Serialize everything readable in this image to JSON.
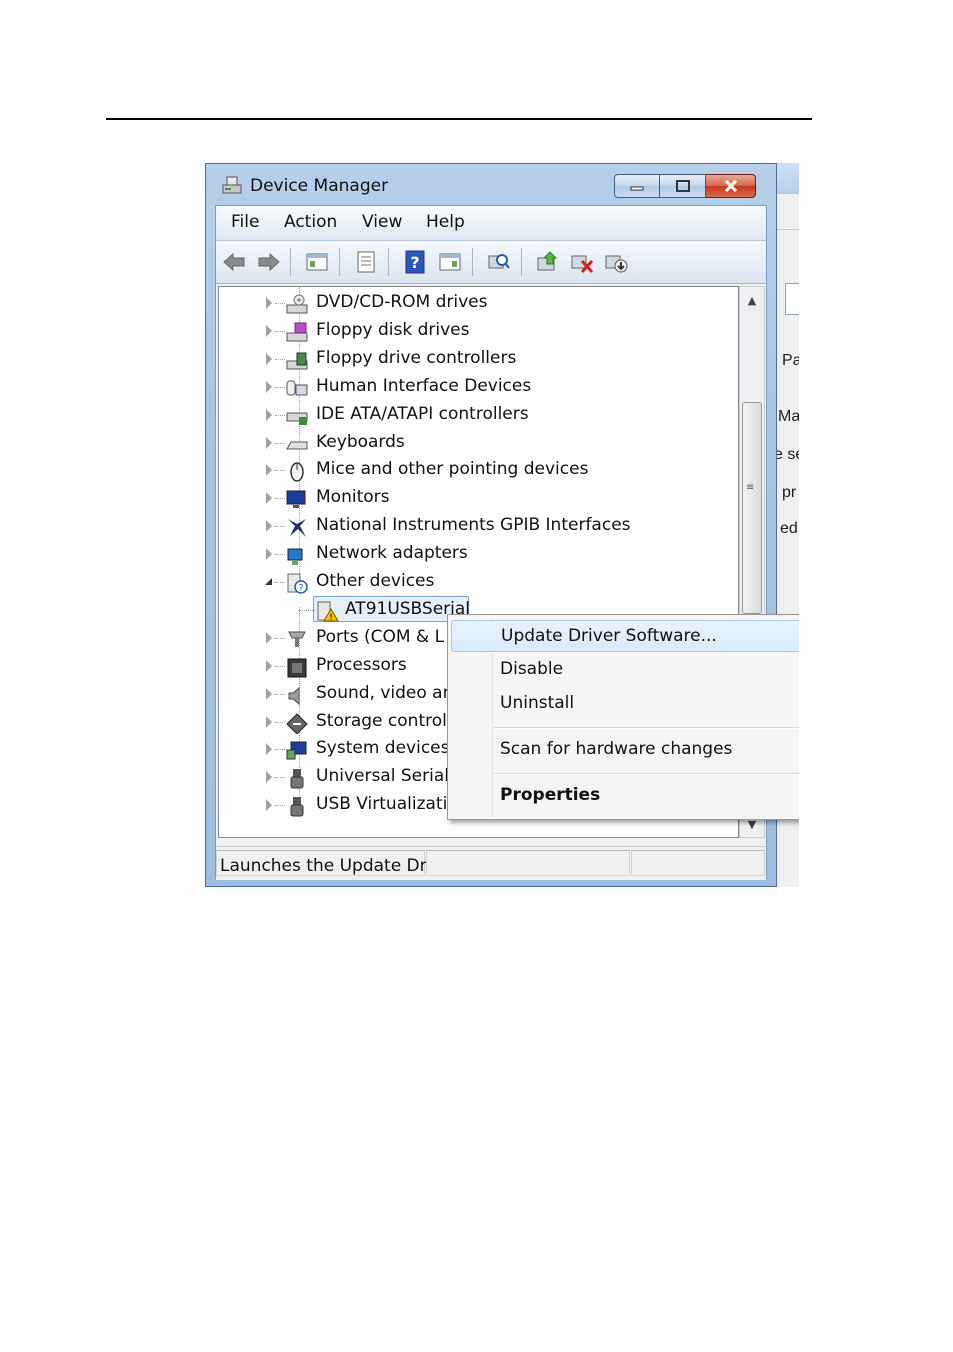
{
  "window": {
    "title": "Device Manager"
  },
  "menu": [
    "File",
    "Action",
    "View",
    "Help"
  ],
  "tree": {
    "categories": [
      {
        "label": "DVD/CD-ROM drives",
        "icon": "dvd-drive-icon"
      },
      {
        "label": "Floppy disk drives",
        "icon": "floppy-drive-icon"
      },
      {
        "label": "Floppy drive controllers",
        "icon": "floppy-controller-icon"
      },
      {
        "label": "Human Interface Devices",
        "icon": "hid-icon"
      },
      {
        "label": "IDE ATA/ATAPI controllers",
        "icon": "ide-controller-icon"
      },
      {
        "label": "Keyboards",
        "icon": "keyboard-icon"
      },
      {
        "label": "Mice and other pointing devices",
        "icon": "mouse-icon"
      },
      {
        "label": "Monitors",
        "icon": "monitor-icon"
      },
      {
        "label": "National Instruments GPIB Interfaces",
        "icon": "ni-gpib-icon"
      },
      {
        "label": "Network adapters",
        "icon": "network-adapter-icon"
      },
      {
        "label": "Other devices",
        "icon": "other-devices-icon",
        "expanded": true
      },
      {
        "label": "AT91USBSerial",
        "icon": "warning-device-icon",
        "child": true,
        "selected": true
      },
      {
        "label": "Ports (COM & L",
        "icon": "port-icon"
      },
      {
        "label": "Processors",
        "icon": "processor-icon"
      },
      {
        "label": "Sound, video an",
        "icon": "sound-icon"
      },
      {
        "label": "Storage controll",
        "icon": "storage-icon"
      },
      {
        "label": "System devices",
        "icon": "system-devices-icon"
      },
      {
        "label": "Universal Serial E",
        "icon": "usb-icon"
      },
      {
        "label": "USB Virtualizatio",
        "icon": "usb-virtualization-icon"
      }
    ]
  },
  "context_menu": {
    "items": [
      {
        "label": "Update Driver Software...",
        "highlighted": true
      },
      {
        "label": "Disable"
      },
      {
        "label": "Uninstall"
      },
      {
        "label": "Scan for hardware changes"
      },
      {
        "label": "Properties",
        "bold": true
      }
    ]
  },
  "status_bar": {
    "text": "Launches the Update Driv"
  },
  "background_window": {
    "fragments": [
      "Pa",
      "Ma",
      "e se",
      "pr",
      "ed"
    ]
  }
}
